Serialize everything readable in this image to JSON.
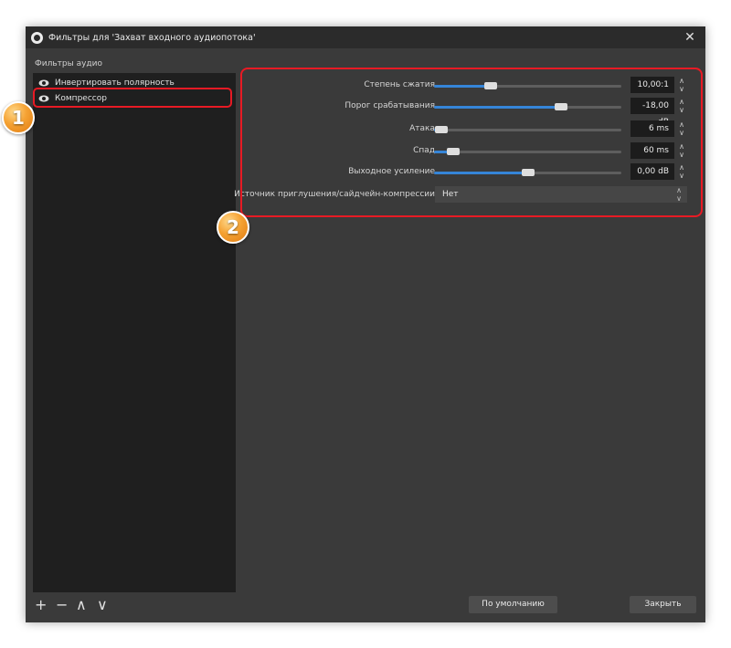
{
  "window": {
    "title": "Фильтры для 'Захват входного аудиопотока'",
    "close_glyph": "✕"
  },
  "filters": {
    "section_label": "Фильтры аудио",
    "items": [
      {
        "label": "Инвертировать полярность"
      },
      {
        "label": "Компрессор"
      }
    ]
  },
  "properties": {
    "ratio": {
      "label": "Степень сжатия",
      "value": "10,00:1",
      "level": 0.3
    },
    "threshold": {
      "label": "Порог срабатывания",
      "value": "-18,00 dB",
      "level": 0.68
    },
    "attack": {
      "label": "Атака",
      "value": "6 ms",
      "level": 0.04
    },
    "release": {
      "label": "Спад",
      "value": "60 ms",
      "level": 0.1
    },
    "output_gain": {
      "label": "Выходное усиление",
      "value": "0,00 dB",
      "level": 0.5
    },
    "sidechain": {
      "label": "Источник приглушения/сайдчейн-компрессии",
      "value": "Нет"
    }
  },
  "toolbar": {
    "add": "+",
    "remove": "−",
    "up": "∧",
    "down": "∨"
  },
  "buttons": {
    "defaults": "По умолчанию",
    "close": "Закрыть"
  },
  "annotations": {
    "badge1": "1",
    "badge2": "2"
  },
  "colors": {
    "accent": "#3585d8",
    "highlight": "#e81a24",
    "badge": "#f5a233",
    "window_bg": "#3a3a3a"
  }
}
